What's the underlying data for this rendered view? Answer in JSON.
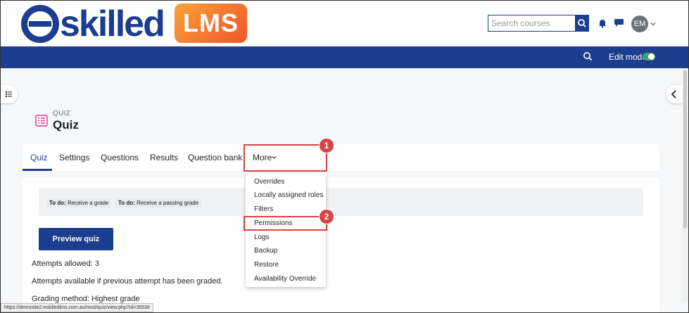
{
  "header": {
    "logo_text": "eskilled",
    "logo_badge": "LMS",
    "search_placeholder": "Search courses",
    "avatar_initials": "EM"
  },
  "navbar": {
    "edit_mode_label": "Edit mode",
    "edit_mode_on": true
  },
  "page": {
    "kicker": "QUIZ",
    "title": "Quiz"
  },
  "tabs": [
    {
      "label": "Quiz",
      "active": true
    },
    {
      "label": "Settings"
    },
    {
      "label": "Questions"
    },
    {
      "label": "Results"
    },
    {
      "label": "Question bank"
    },
    {
      "label": "More"
    }
  ],
  "todo": [
    {
      "prefix": "To do:",
      "text": "Receive a grade"
    },
    {
      "prefix": "To do:",
      "text": "Receive a passing grade"
    }
  ],
  "preview_button": "Preview quiz",
  "info_lines": [
    "Attempts allowed: 3",
    "Attempts available if previous attempt has been graded.",
    "Grading method: Highest grade"
  ],
  "more_menu": [
    "Overrides",
    "Locally assigned roles",
    "Filters",
    "Permissions",
    "Logs",
    "Backup",
    "Restore",
    "Availability Override"
  ],
  "callouts": [
    "1",
    "2"
  ],
  "status_url": "https://demosite2.eskilledlms.com.au/mod/quiz/view.php?id=3553#",
  "colors": {
    "brand": "#1d3e8f",
    "callout": "#d64541",
    "toggle_on": "#4e9a6a"
  }
}
